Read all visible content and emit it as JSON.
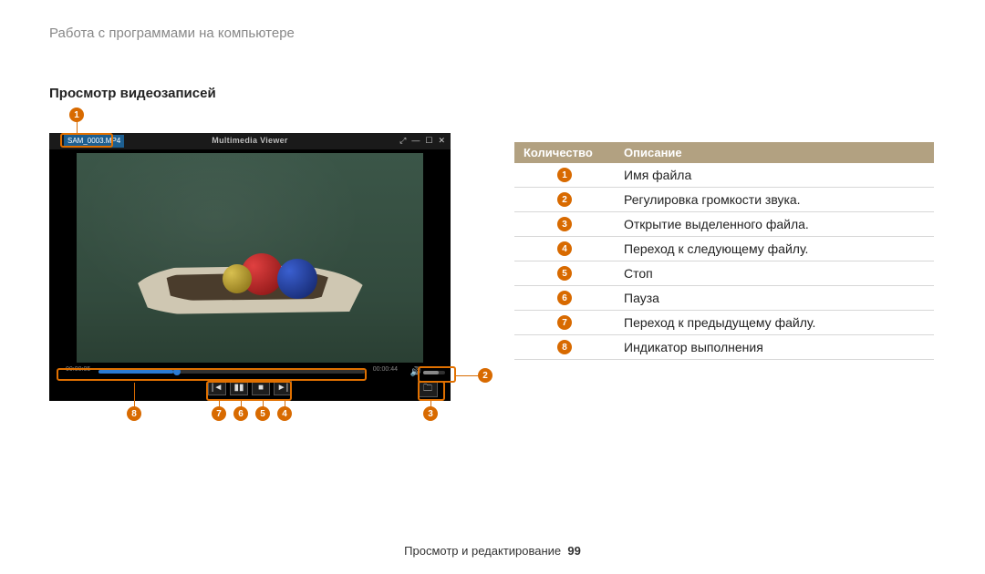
{
  "breadcrumb": "Работа с программами на компьютере",
  "section_title": "Просмотр видеозаписей",
  "player": {
    "file_tab": "SAM_0003.MP4",
    "window_title": "Multimedia Viewer",
    "time_left": "00:00:05",
    "time_right": "00:00:44"
  },
  "table": {
    "header_num": "Количество",
    "header_desc": "Описание",
    "rows": [
      {
        "n": "1",
        "desc": "Имя файла"
      },
      {
        "n": "2",
        "desc": "Регулировка громкости звука."
      },
      {
        "n": "3",
        "desc": "Открытие выделенного файла."
      },
      {
        "n": "4",
        "desc": "Переход к следующему файлу."
      },
      {
        "n": "5",
        "desc": "Стоп"
      },
      {
        "n": "6",
        "desc": "Пауза"
      },
      {
        "n": "7",
        "desc": "Переход к предыдущему файлу."
      },
      {
        "n": "8",
        "desc": "Индикатор выполнения"
      }
    ]
  },
  "callouts": {
    "b1": "1",
    "b2": "2",
    "b3": "3",
    "b4": "4",
    "b5": "5",
    "b6": "6",
    "b7": "7",
    "b8": "8"
  },
  "footer": {
    "label": "Просмотр и редактирование",
    "page": "99"
  }
}
